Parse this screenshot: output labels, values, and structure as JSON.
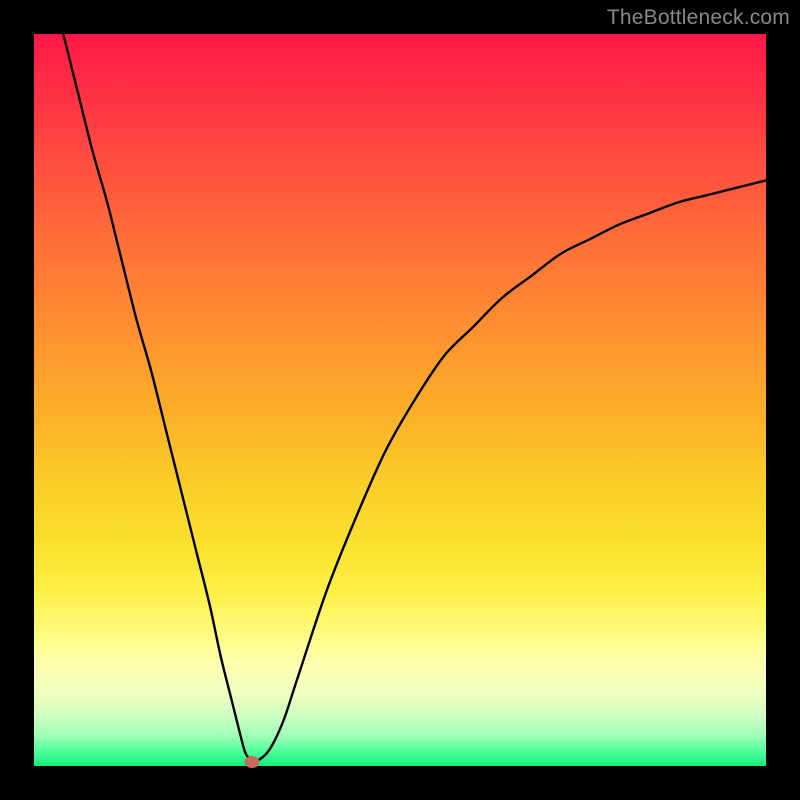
{
  "watermark": "TheBottleneck.com",
  "colors": {
    "background": "#000000",
    "curve": "#000000",
    "dot": "#c9695c"
  },
  "chart_data": {
    "type": "line",
    "title": "",
    "xlabel": "",
    "ylabel": "",
    "xlim": [
      0,
      100
    ],
    "ylim": [
      0,
      100
    ],
    "grid": false,
    "series": [
      {
        "name": "bottleneck-curve",
        "x": [
          4,
          6,
          8,
          10,
          12,
          14,
          16,
          18,
          20,
          22,
          24,
          25.5,
          27,
          28,
          28.8,
          29.4,
          30,
          32,
          34,
          36,
          40,
          44,
          48,
          52,
          56,
          60,
          64,
          68,
          72,
          76,
          80,
          84,
          88,
          92,
          96,
          100
        ],
        "y": [
          100,
          92,
          84,
          77,
          69,
          61,
          54,
          46,
          38,
          30,
          22,
          15,
          9,
          5,
          2,
          1,
          0.5,
          2,
          6,
          12,
          24,
          34,
          43,
          50,
          56,
          60,
          64,
          67,
          70,
          72,
          74,
          75.5,
          77,
          78,
          79,
          80
        ]
      }
    ],
    "marker": {
      "name": "bottleneck-dot",
      "x": 29.8,
      "y": 0.5
    },
    "gradient_stops": [
      {
        "pos": 0,
        "color": "#ff1846"
      },
      {
        "pos": 16,
        "color": "#ff4940"
      },
      {
        "pos": 40,
        "color": "#ff8f30"
      },
      {
        "pos": 62,
        "color": "#facf28"
      },
      {
        "pos": 82,
        "color": "#fffc80"
      },
      {
        "pos": 93,
        "color": "#d0ffc3"
      },
      {
        "pos": 100,
        "color": "#11f07b"
      }
    ]
  }
}
